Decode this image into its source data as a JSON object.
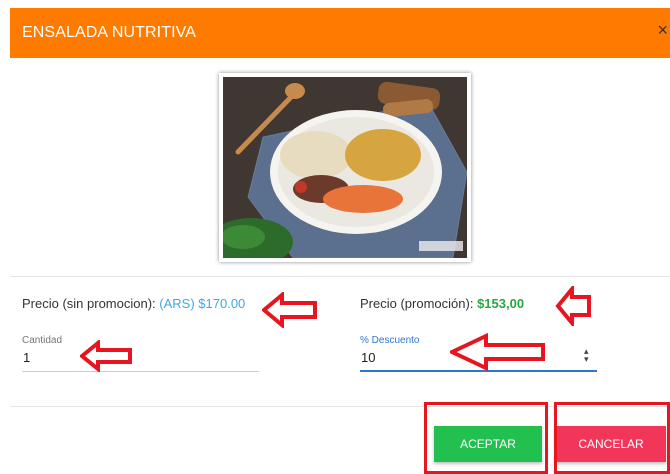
{
  "dialog": {
    "title": "ENSALADA NUTRITIVA",
    "close_glyph": "×"
  },
  "product": {
    "image_caption": ""
  },
  "prices": {
    "regular_label": "Precio (sin promocion):",
    "regular_value": "(ARS) $170.00",
    "promo_label": "Precio (promoción):",
    "promo_value": "$153,00"
  },
  "fields": {
    "quantity_label": "Cantidad",
    "quantity_value": "1",
    "discount_label": "% Descuento",
    "discount_value": "10"
  },
  "buttons": {
    "accept": "ACEPTAR",
    "cancel": "CANCELAR"
  },
  "colors": {
    "header": "#ff7b00",
    "regular_price": "#3fa9e0",
    "promo_price": "#27a745",
    "accept": "#22c04f",
    "cancel": "#f2365a",
    "annotation": "#e8141f"
  },
  "annotations": {
    "icon": "red-arrow-icon"
  }
}
